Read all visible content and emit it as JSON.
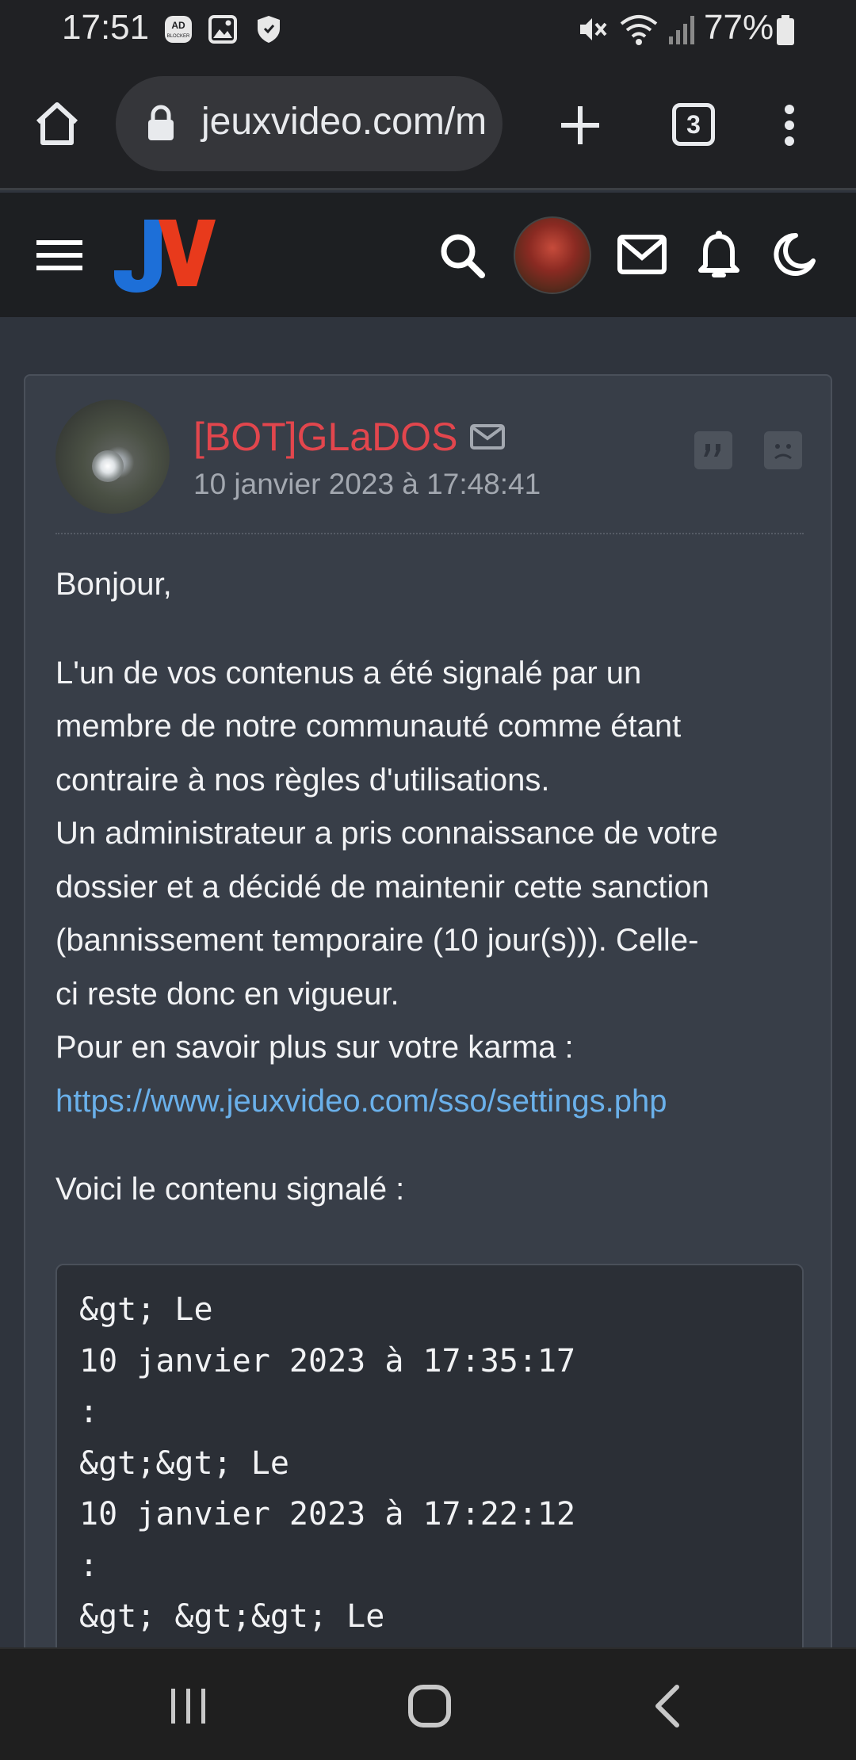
{
  "status_bar": {
    "time": "17:51",
    "battery": "77%",
    "left_icons": [
      "ad-blocker-icon",
      "image-icon",
      "shield-icon"
    ],
    "right_icons": [
      "mute-icon",
      "wifi-icon",
      "signal-icon",
      "battery-icon"
    ]
  },
  "browser": {
    "url": "jeuxvideo.com/m",
    "tab_count": "3"
  },
  "site_header": {
    "logo": "JV",
    "brand_colors": {
      "j": "#1d6fd8",
      "v": "#e83a1c"
    }
  },
  "post": {
    "author": "[BOT]GLaDOS",
    "date": "10 janvier 2023 à 17:48:41",
    "greeting": "Bonjour,",
    "paragraph_lines": [
      "L'un de vos contenus a été signalé par un",
      "membre de notre communauté comme étant",
      "contraire à nos règles d'utilisations.",
      "Un administrateur a pris connaissance de votre",
      "dossier et a décidé de maintenir cette sanction",
      "(bannissement temporaire (10 jour(s))). Celle-",
      "ci reste donc en vigueur.",
      "Pour en savoir plus sur votre karma :"
    ],
    "link": "https://www.jeuxvideo.com/sso/settings.php",
    "quoted_intro": "Voici le contenu signalé :",
    "code_lines": [
      "&gt; Le",
      "10 janvier 2023 à 17:35:17",
      ":",
      "&gt;&gt; Le",
      "10 janvier 2023 à 17:22:12",
      ":",
      "&gt; &gt;&gt; Le"
    ]
  },
  "colors": {
    "author": "#e2464d",
    "link": "#6ab0ea",
    "card_bg": "#383e48"
  }
}
